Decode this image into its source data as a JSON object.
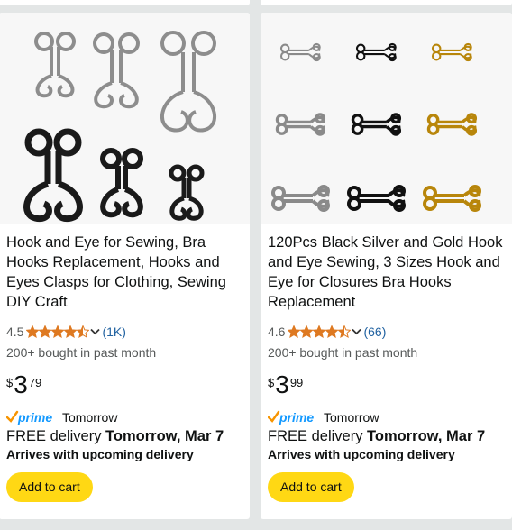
{
  "products": [
    {
      "title": "Hook and Eye for Sewing, Bra Hooks Replacement, Hooks and Eyes Clasps for Clothing, Sewing DIY Craft",
      "rating": "4.5",
      "rating_stars": 4.5,
      "review_count": "(1K)",
      "bought": "200+ bought in past month",
      "price_symbol": "$",
      "price_whole": "3",
      "price_fraction": "79",
      "prime_label": "prime",
      "prime_day": "Tomorrow",
      "delivery_prefix": "FREE delivery",
      "delivery_date": "Tomorrow, Mar 7",
      "arrives": "Arrives with upcoming delivery",
      "cart_label": "Add to cart",
      "image_icon": "hook-and-eye-set-icon"
    },
    {
      "title": "120Pcs Black Silver and Gold Hook and Eye Sewing, 3 Sizes Hook and Eye for Closures Bra Hooks Replacement",
      "rating": "4.6",
      "rating_stars": 4.5,
      "review_count": "(66)",
      "bought": "200+ bought in past month",
      "price_symbol": "$",
      "price_whole": "3",
      "price_fraction": "99",
      "prime_label": "prime",
      "prime_day": "Tomorrow",
      "delivery_prefix": "FREE delivery",
      "delivery_date": "Tomorrow, Mar 7",
      "arrives": "Arrives with upcoming delivery",
      "cart_label": "Add to cart",
      "image_icon": "hook-grid-icon"
    }
  ],
  "colors": {
    "star": "#de7921",
    "link": "#2162a1",
    "prime_blue": "#1399ff",
    "prime_check": "#f79400",
    "button": "#ffd814",
    "silver": "#c0c0c0",
    "black_metal": "#1a1a1a",
    "gold": "#d9a520"
  }
}
